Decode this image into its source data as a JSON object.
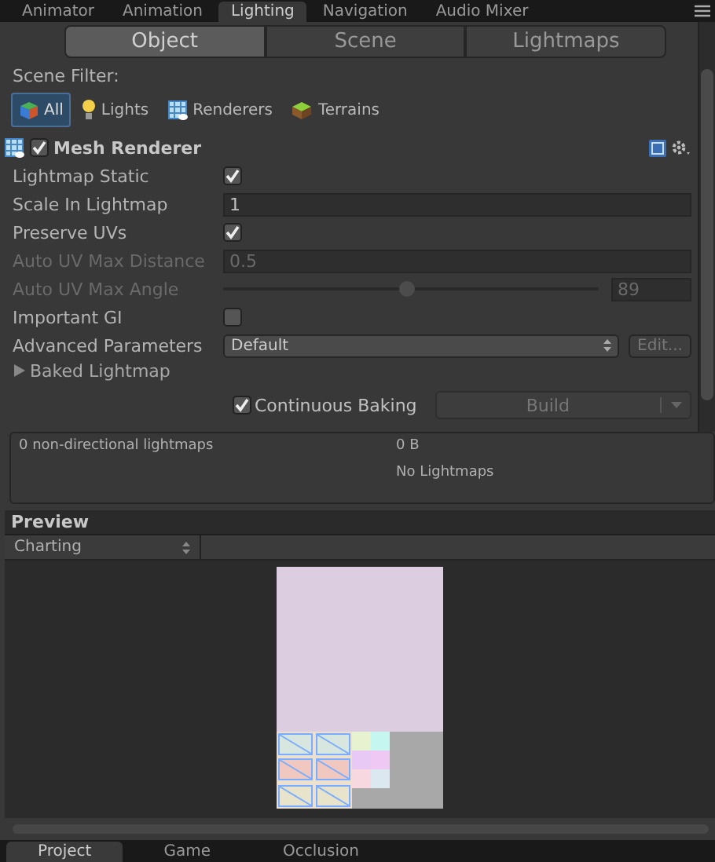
{
  "dock_tabs": [
    {
      "label": "Animator",
      "selected": false
    },
    {
      "label": "Animation",
      "selected": false
    },
    {
      "label": "Lighting",
      "selected": true
    },
    {
      "label": "Navigation",
      "selected": false
    },
    {
      "label": "Audio Mixer",
      "selected": false
    }
  ],
  "mode_tabs": [
    {
      "label": "Object",
      "selected": true
    },
    {
      "label": "Scene",
      "selected": false
    },
    {
      "label": "Lightmaps",
      "selected": false
    }
  ],
  "scene_filter": {
    "label": "Scene Filter:",
    "options": [
      {
        "label": "All",
        "selected": true
      },
      {
        "label": "Lights",
        "selected": false
      },
      {
        "label": "Renderers",
        "selected": false
      },
      {
        "label": "Terrains",
        "selected": false
      }
    ]
  },
  "component": {
    "title": "Mesh Renderer",
    "enabled": true,
    "properties": [
      {
        "kind": "checkbox",
        "label": "Lightmap Static",
        "checked": true,
        "disabled": false
      },
      {
        "kind": "number",
        "label": "Scale In Lightmap",
        "value": "1",
        "disabled": false
      },
      {
        "kind": "checkbox",
        "label": "Preserve UVs",
        "checked": true,
        "disabled": false
      },
      {
        "kind": "number",
        "label": "Auto UV Max Distance",
        "value": "0.5",
        "disabled": true
      },
      {
        "kind": "slider",
        "label": "Auto UV Max Angle",
        "level": 0.49,
        "value": "89",
        "disabled": true
      },
      {
        "kind": "checkbox",
        "label": "Important GI",
        "checked": false,
        "disabled": false
      },
      {
        "kind": "dropdown",
        "label": "Advanced Parameters",
        "value": "Default",
        "button": "Edit...",
        "disabled": false
      }
    ],
    "foldout": {
      "label": "Baked Lightmap",
      "expanded": false
    }
  },
  "continuous_baking": {
    "label": "Continuous Baking",
    "checked": true
  },
  "build_button": {
    "label": "Build",
    "disabled": true
  },
  "stats": {
    "lightmaps": "0 non-directional lightmaps",
    "size": "0 B",
    "status": "No Lightmaps"
  },
  "preview": {
    "title": "Preview",
    "mode": "Charting"
  },
  "bottom_tabs": [
    {
      "label": "Project",
      "selected": true
    },
    {
      "label": "Game",
      "selected": false
    },
    {
      "label": "Occlusion",
      "selected": false
    }
  ]
}
